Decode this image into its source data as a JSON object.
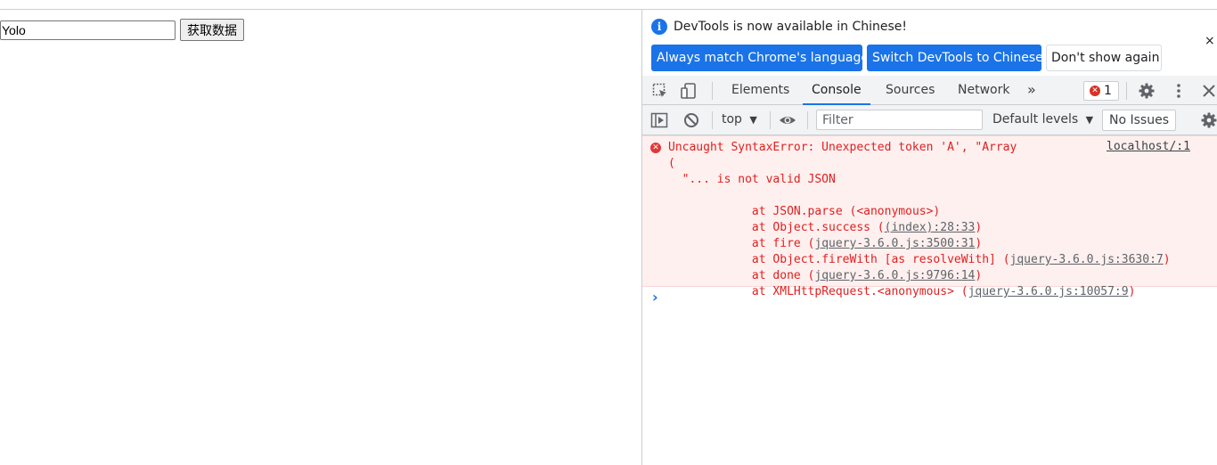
{
  "page": {
    "input_value": "Yolo",
    "button_label": "获取数据"
  },
  "devtools": {
    "infobar": {
      "icon": "info-icon",
      "message": "DevTools is now available in Chinese!",
      "buttons": [
        "Always match Chrome's language",
        "Switch DevTools to Chinese",
        "Don't show again"
      ],
      "close": "×"
    },
    "tabs": {
      "items": [
        "Elements",
        "Console",
        "Sources",
        "Network"
      ],
      "active": "Console",
      "more": "»",
      "error_count": "1"
    },
    "toolbar": {
      "context": "top",
      "context_arrow": "▼",
      "filter_placeholder": "Filter",
      "levels": "Default levels",
      "levels_arrow": "▼",
      "issues": "No Issues"
    },
    "console": {
      "error": {
        "line1": "Uncaught SyntaxError: Unexpected token 'A', \"Array",
        "line2": "(",
        "line3": "  \"... is not valid JSON",
        "source": "localhost/:1",
        "stack": [
          {
            "prefix": "    at JSON.parse (<anonymous>)",
            "link": "",
            "suffix": ""
          },
          {
            "prefix": "    at Object.success (",
            "link": "(index):28:33",
            "suffix": ")"
          },
          {
            "prefix": "    at fire (",
            "link": "jquery-3.6.0.js:3500:31",
            "suffix": ")"
          },
          {
            "prefix": "    at Object.fireWith [as resolveWith] (",
            "link": "jquery-3.6.0.js:3630:7",
            "suffix": ")"
          },
          {
            "prefix": "    at done (",
            "link": "jquery-3.6.0.js:9796:14",
            "suffix": ")"
          },
          {
            "prefix": "    at XMLHttpRequest.<anonymous> (",
            "link": "jquery-3.6.0.js:10057:9",
            "suffix": ")"
          }
        ]
      },
      "prompt": "›"
    }
  },
  "colors": {
    "accent": "#1a73e8",
    "error": "#e02020",
    "error_bg": "#fef0ef"
  }
}
